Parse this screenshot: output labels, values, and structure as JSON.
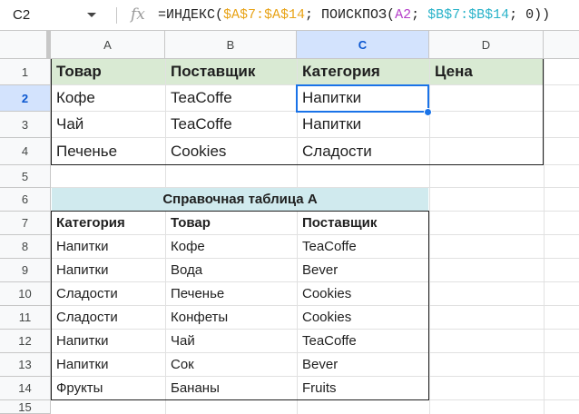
{
  "namebox": "C2",
  "formula": {
    "prefix": "=ИНДЕКС(",
    "ref1": "$A$7:$A$14",
    "mid1": "; ПОИСКПОЗ(",
    "ref2": "A2",
    "mid2": "; ",
    "ref3": "$B$7:$B$14",
    "suffix": "; 0))"
  },
  "columns": [
    "A",
    "B",
    "C",
    "D"
  ],
  "rows": [
    "1",
    "2",
    "3",
    "4",
    "5",
    "6",
    "7",
    "8",
    "9",
    "10",
    "11",
    "12",
    "13",
    "14",
    "15"
  ],
  "table1": {
    "headers": [
      "Товар",
      "Поставщик",
      "Категория",
      "Цена"
    ],
    "rows": [
      [
        "Кофе",
        "TeaCoffe",
        "Напитки"
      ],
      [
        "Чай",
        "TeaCoffe",
        "Напитки"
      ],
      [
        "Печенье",
        "Cookies",
        "Сладости"
      ]
    ]
  },
  "table2": {
    "title": "Справочная таблица А",
    "headers": [
      "Категория",
      "Товар",
      "Поставщик"
    ],
    "rows": [
      [
        "Напитки",
        "Кофе",
        "TeaCoffe"
      ],
      [
        "Напитки",
        "Вода",
        "Bever"
      ],
      [
        "Сладости",
        "Печенье",
        "Cookies"
      ],
      [
        "Сладости",
        "Конфеты",
        "Cookies"
      ],
      [
        "Напитки",
        "Чай",
        "TeaCoffe"
      ],
      [
        "Напитки",
        "Сок",
        "Bever"
      ],
      [
        "Фрукты",
        "Бананы",
        "Fruits"
      ]
    ]
  },
  "colors": {
    "header_green": "#d9ead3",
    "title_teal": "#d0eaee",
    "selection_blue": "#1a73e8"
  }
}
